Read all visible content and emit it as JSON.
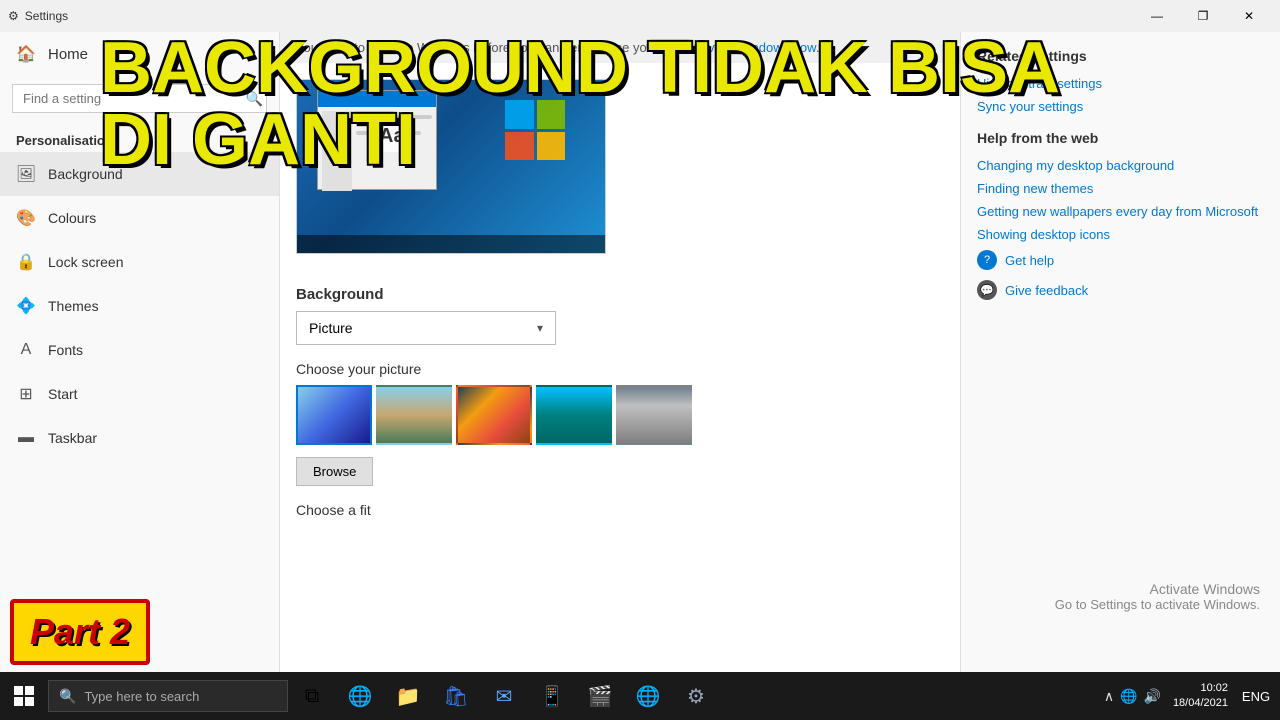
{
  "titleBar": {
    "title": "Settings",
    "minimizeLabel": "—",
    "maximizeLabel": "❐",
    "closeLabel": "✕"
  },
  "sidebar": {
    "homeLabel": "Home",
    "searchPlaceholder": "Find a setting",
    "sectionTitle": "Personalisation",
    "items": [
      {
        "id": "background",
        "label": "Background",
        "icon": "🖼"
      },
      {
        "id": "colours",
        "label": "Colours",
        "icon": "🎨"
      },
      {
        "id": "lock-screen",
        "label": "Lock screen",
        "icon": "🔒"
      },
      {
        "id": "themes",
        "label": "Themes",
        "icon": "💠"
      },
      {
        "id": "fonts",
        "label": "Fonts",
        "icon": "Ꞷ"
      },
      {
        "id": "start",
        "label": "Start",
        "icon": "⊞"
      },
      {
        "id": "taskbar",
        "label": "Taskbar",
        "icon": "▬"
      }
    ]
  },
  "main": {
    "activationMessage": "You need to activate Windows before you can personalise your PC.",
    "activationLinkText": "Activate Windows now.",
    "backgroundSectionLabel": "Background",
    "dropdownValue": "Picture",
    "choosePictureLabel": "Choose your picture",
    "browseLabel": "Browse",
    "chooseFitLabel": "Choose a fit"
  },
  "rightPanel": {
    "relatedTitle": "Related Settings",
    "relatedLinks": [
      "High contrast settings",
      "Sync your settings"
    ],
    "helpTitle": "Help from the web",
    "helpLinks": [
      "Changing my desktop background",
      "Finding new themes",
      "Getting new wallpapers every day from Microsoft",
      "Showing desktop icons"
    ],
    "getHelp": "Get help",
    "giveFeedback": "Give feedback",
    "activateTitle": "Activate Windows",
    "activateDesc": "Go to Settings to activate Windows."
  },
  "overlay": {
    "line1": "BACKGROUND TIDAK BISA",
    "line2": "DI GANTI"
  },
  "part2": "Part 2",
  "taskbar": {
    "searchPlaceholder": "Type here to search",
    "time": "10:02",
    "date": "18/04/2021"
  }
}
